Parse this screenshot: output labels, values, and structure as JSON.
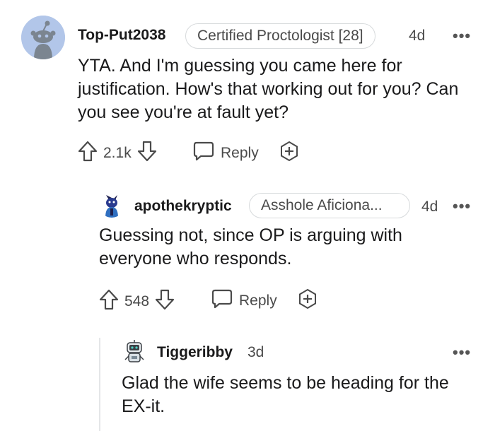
{
  "comments": [
    {
      "username": "Top-Put2038",
      "flair": "Certified Proctologist [28]",
      "time": "4d",
      "body": "YTA. And I'm guessing you came here for justification. How's that working out for you? Can you see you're at fault yet?",
      "votes": "2.1k",
      "reply_label": "Reply",
      "avatar_icon": "snoo-avatar-icon"
    },
    {
      "username": "apothekryptic",
      "flair": "Asshole Aficiona...",
      "time": "4d",
      "body": "Guessing not, since OP is arguing with everyone who responds.",
      "votes": "548",
      "reply_label": "Reply",
      "avatar_icon": "custom-avatar-icon"
    },
    {
      "username": "Tiggeribby",
      "time": "3d",
      "body": "Glad the wife seems to be heading for the EX-it.",
      "avatar_icon": "robot-avatar-icon"
    }
  ],
  "colors": {
    "text": "#1a1a1b",
    "muted": "#4a4a4a",
    "flair_border": "#d7dadc",
    "avatar_bg": "#b2c6e9",
    "thread_line": "#e4e6e8"
  },
  "more_label": "•••"
}
